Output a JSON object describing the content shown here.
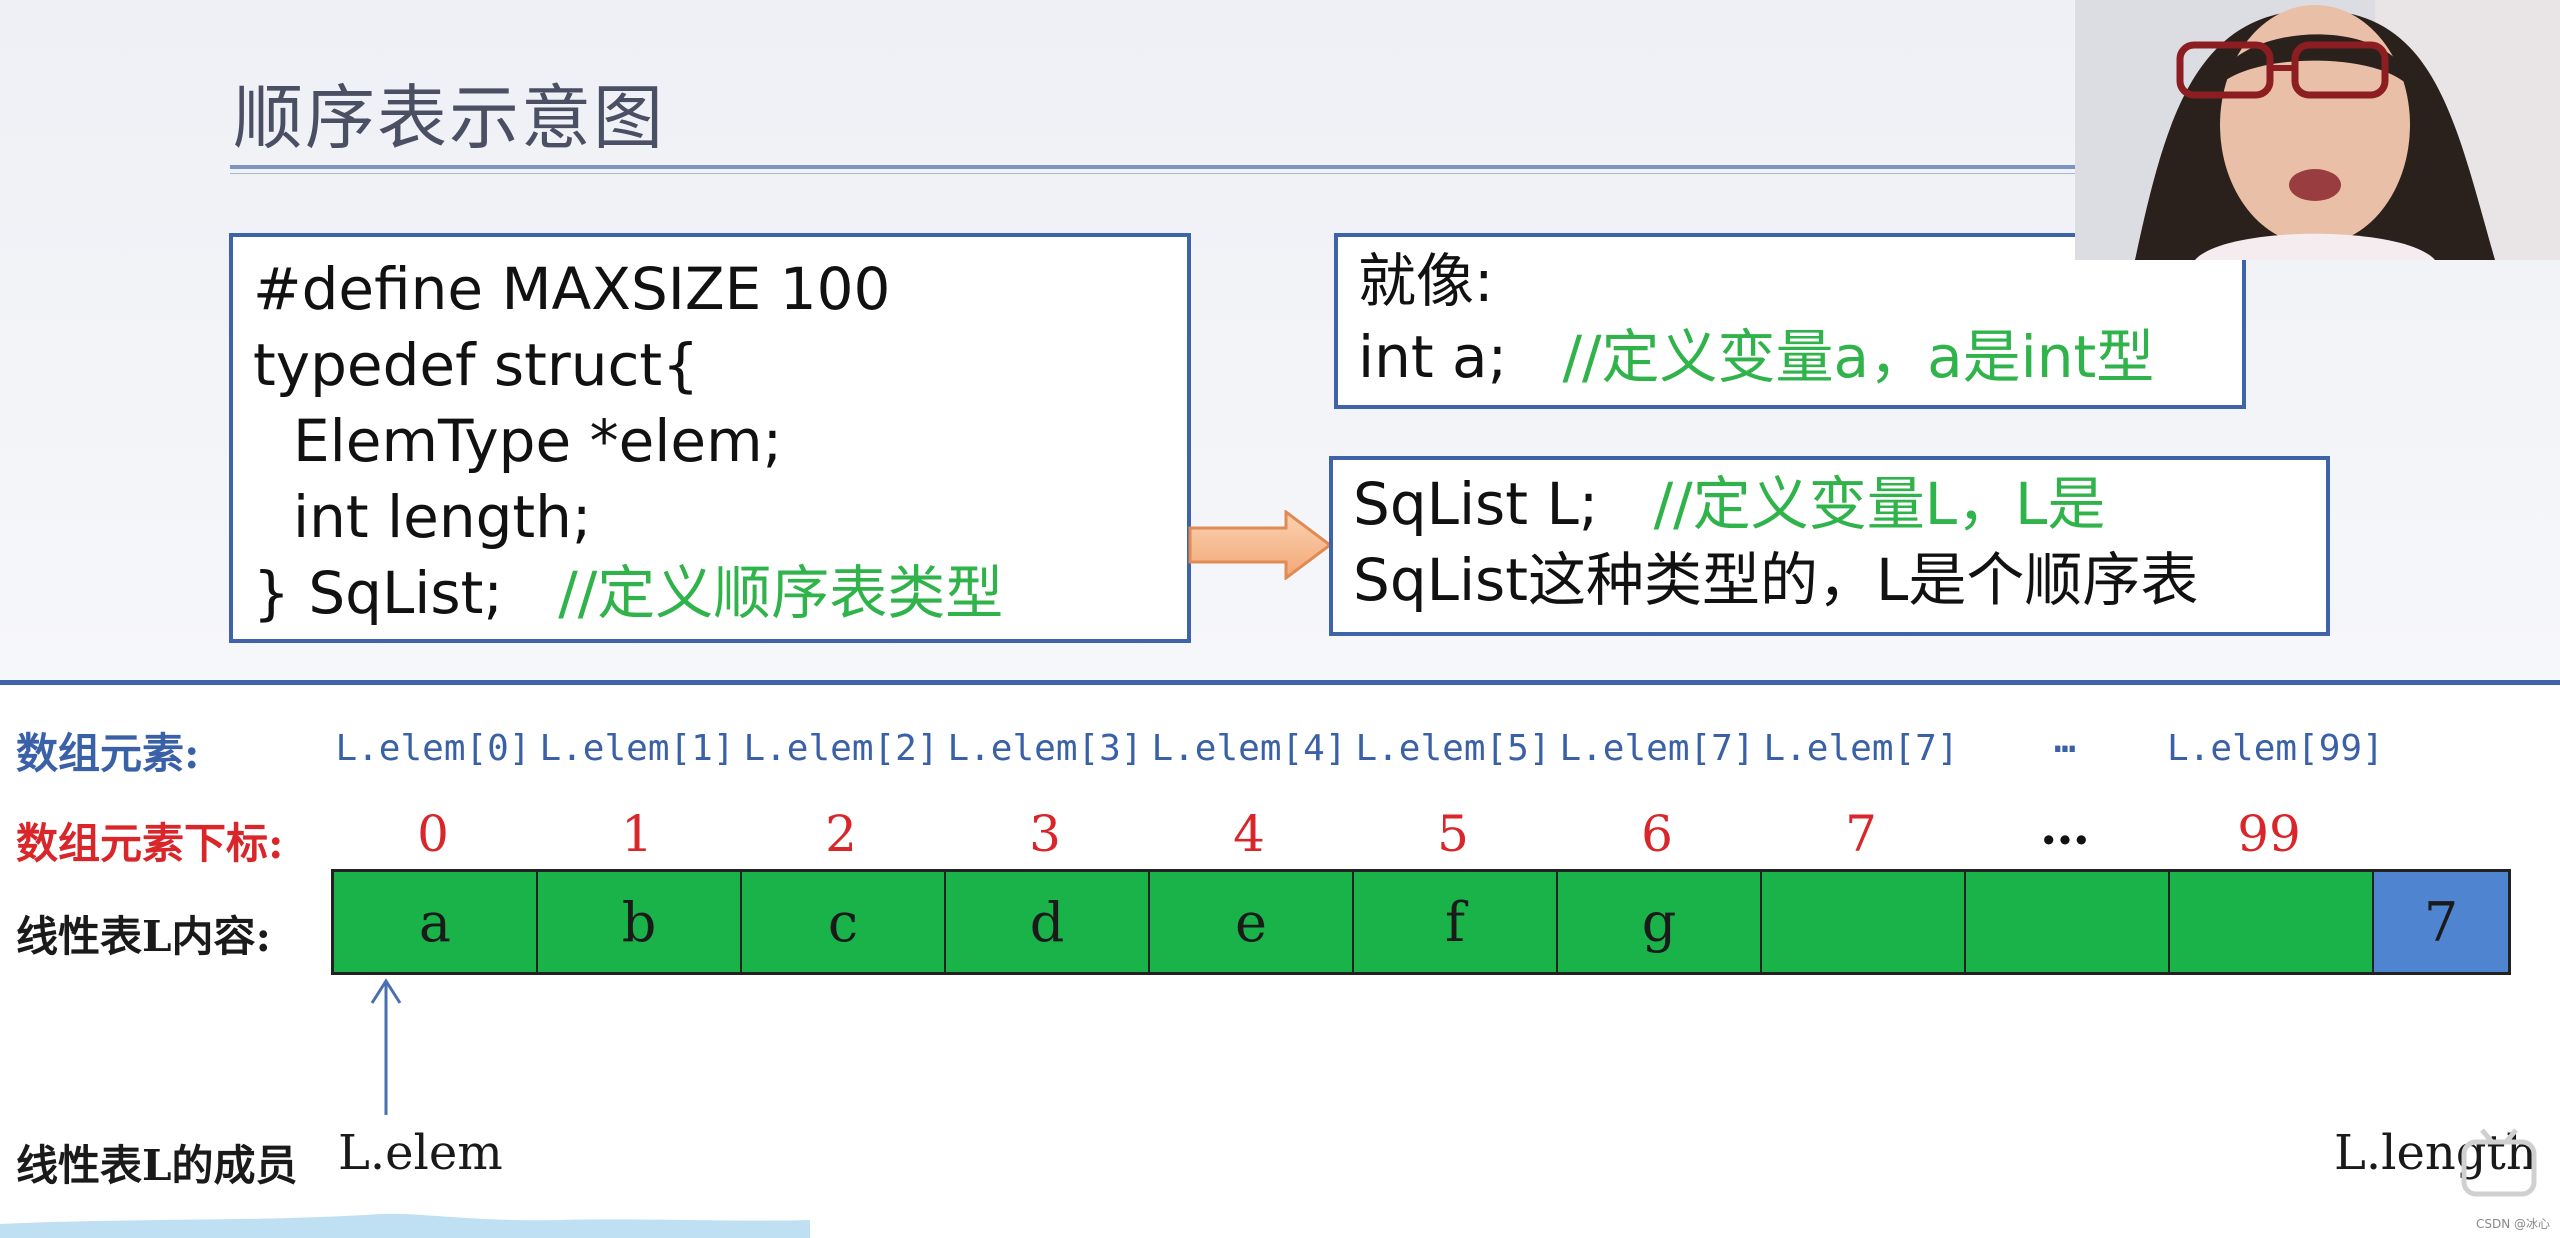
{
  "slide": {
    "title": "顺序表示意图"
  },
  "code": {
    "lines": [
      "#define MAXSIZE 100",
      "typedef struct{",
      "ElemType *elem;",
      "int length;",
      "} SqList;"
    ],
    "comment": "//定义顺序表类型"
  },
  "like_box": {
    "heading": "就像:",
    "code": "int a;",
    "comment": "//定义变量a，a是int型"
  },
  "sqlist_box": {
    "code": "SqList L;",
    "comment_line1": "//定义变量L，L是",
    "comment_line2": "SqList这种类型的，L是个顺序表"
  },
  "diagram": {
    "row_labels": {
      "elements": "数组元素:",
      "indices": "数组元素下标:",
      "contents": "线性表L内容:",
      "members": "线性表L的成员"
    },
    "element_names": [
      "L.elem[0]",
      "L.elem[1]",
      "L.elem[2]",
      "L.elem[3]",
      "L.elem[4]",
      "L.elem[5]",
      "L.elem[7]",
      "L.elem[7]",
      "…",
      "L.elem[99]"
    ],
    "indices": [
      "0",
      "1",
      "2",
      "3",
      "4",
      "5",
      "6",
      "7",
      "…",
      "99"
    ],
    "cells": [
      "a",
      "b",
      "c",
      "d",
      "e",
      "f",
      "g",
      "",
      "",
      ""
    ],
    "length_value": "7",
    "member_elem": "L.elem",
    "member_length": "L.length"
  },
  "colors": {
    "border_blue": "#3e63a8",
    "cell_green": "#19b34a",
    "length_blue": "#4f85d0",
    "index_red": "#d8262a",
    "comment_green": "#2fb34a"
  },
  "watermark": "CSDN @冰心"
}
